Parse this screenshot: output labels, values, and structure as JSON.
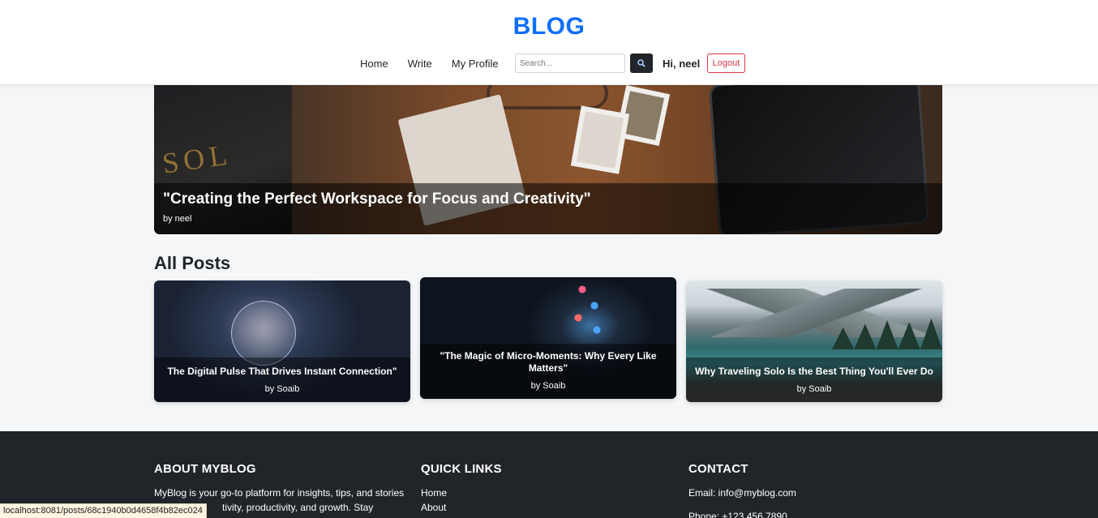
{
  "header": {
    "brand": "BLOG",
    "nav": [
      "Home",
      "Write",
      "My Profile"
    ],
    "search_placeholder": "Search...",
    "search_icon": "magnifier-icon",
    "greeting": "Hi, neel",
    "logout_label": "Logout"
  },
  "hero": {
    "title": "\"Creating the Perfect Workspace for Focus and Creativity\"",
    "author": "by neel",
    "book_text": "SOL"
  },
  "posts": {
    "section_title": "All Posts",
    "items": [
      {
        "title": "The Digital Pulse That Drives Instant Connection\"",
        "author": "by Soaib"
      },
      {
        "title": "\"The Magic of Micro-Moments: Why Every Like Matters\"",
        "author": "by Soaib"
      },
      {
        "title": "Why Traveling Solo Is the Best Thing You'll Ever Do",
        "author": "by Soaib"
      }
    ]
  },
  "footer": {
    "about": {
      "heading": "ABOUT MYBLOG",
      "text_line1": "MyBlog is your go-to platform for insights, tips, and stories",
      "text_line2": "tivity, productivity, and growth. Stay"
    },
    "links": {
      "heading": "QUICK LINKS",
      "items": [
        "Home",
        "About"
      ]
    },
    "contact": {
      "heading": "CONTACT",
      "email": "Email: info@myblog.com",
      "phone": "Phone: +123 456 7890"
    }
  },
  "status_bar": {
    "url": "localhost:8081/posts/68c1940b0d4658f4b82ec024"
  },
  "colors": {
    "brand": "#0d6efd",
    "logout": "#dc3545",
    "footer_bg": "#212529"
  }
}
